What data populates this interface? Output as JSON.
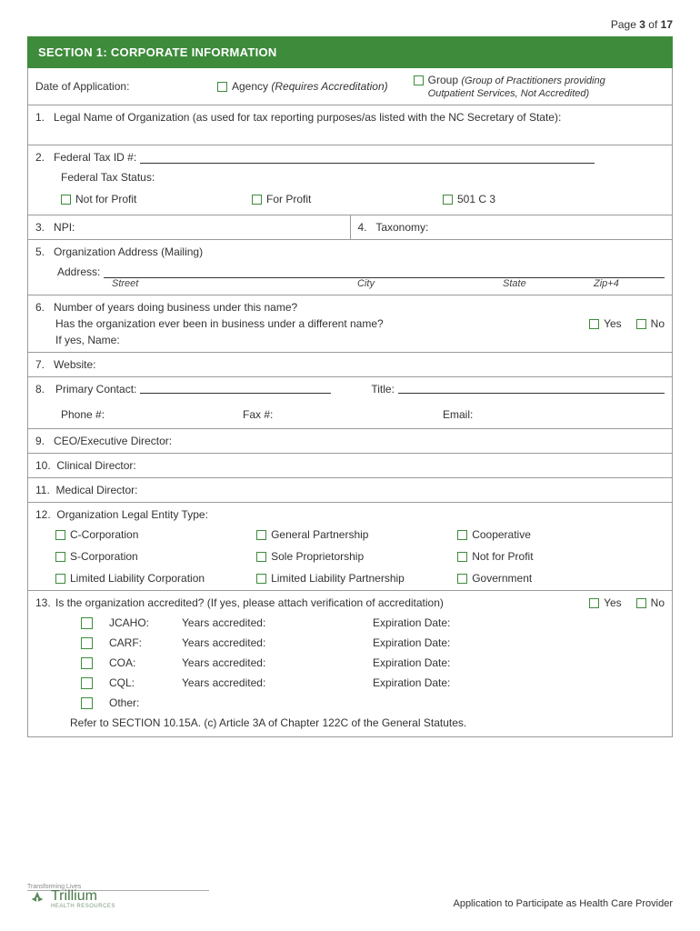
{
  "page": {
    "prefix": "Page",
    "current": "3",
    "of_word": "of",
    "total": "17"
  },
  "section_title": "SECTION 1: CORPORATE INFORMATION",
  "header_row": {
    "date_label": "Date of Application:",
    "agency_label": "Agency",
    "agency_note": "(Requires Accreditation)",
    "group_label": "Group",
    "group_note": "(Group of Practitioners providing Outpatient Services, Not Accredited)"
  },
  "q1": {
    "num": "1.",
    "text": "Legal Name of Organization (as used for tax reporting purposes/as listed with the NC Secretary of State):"
  },
  "q2": {
    "num": "2.",
    "text": "Federal Tax ID #:",
    "status_label": "Federal Tax Status:",
    "opts": [
      "Not for Profit",
      "For Profit",
      "501 C 3"
    ]
  },
  "q3": {
    "num": "3.",
    "text": "NPI:"
  },
  "q4": {
    "num": "4.",
    "text": "Taxonomy:"
  },
  "q5": {
    "num": "5.",
    "text": "Organization Address (Mailing)",
    "addr_label": "Address:",
    "cols": {
      "street": "Street",
      "city": "City",
      "state": "State",
      "zip": "Zip+4"
    }
  },
  "q6": {
    "num": "6.",
    "line1": "Number of years doing business under this name?",
    "line2": "Has the organization ever been in business under a different name?",
    "ifyes": "If yes, Name:",
    "yes": "Yes",
    "no": "No"
  },
  "q7": {
    "num": "7.",
    "text": "Website:"
  },
  "q8": {
    "num": "8.",
    "contact": "Primary Contact:",
    "title": "Title:",
    "phone": "Phone #:",
    "fax": "Fax #:",
    "email": "Email:"
  },
  "q9": {
    "num": "9.",
    "text": "CEO/Executive Director:"
  },
  "q10": {
    "num": "10.",
    "text": "Clinical Director:"
  },
  "q11": {
    "num": "11.",
    "text": "Medical Director:"
  },
  "q12": {
    "num": "12.",
    "text": "Organization Legal Entity Type:",
    "opts": [
      "C-Corporation",
      "General Partnership",
      "Cooperative",
      "S-Corporation",
      "Sole Proprietorship",
      "Not for Profit",
      "Limited Liability Corporation",
      "Limited Liability Partnership",
      "Government"
    ]
  },
  "q13": {
    "num": "13.",
    "text": "Is the organization accredited? (If yes, please attach verification of accreditation)",
    "yes": "Yes",
    "no": "No",
    "years_label": "Years accredited:",
    "exp_label": "Expiration Date:",
    "bodies": [
      "JCAHO:",
      "CARF:",
      "COA:",
      "CQL:",
      "Other:"
    ],
    "refer": "Refer to SECTION 10.15A. (c) Article 3A of Chapter 122C of the General Statutes."
  },
  "footer": {
    "tagline": "Transforming Lives",
    "logo_name": "Trillium",
    "logo_sub": "HEALTH RESOURCES",
    "right": "Application to Participate as Health Care Provider"
  }
}
